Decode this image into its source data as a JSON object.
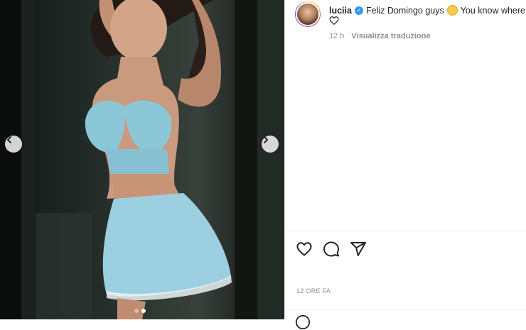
{
  "post": {
    "username": "luciia",
    "caption_pre": "Feliz Domingo guys",
    "caption_post": "You know where",
    "time_short": "12 h",
    "translate_label": "Visualizza traduzione",
    "time_long": "12 ORE FA"
  },
  "carousel": {
    "slide_count": 2,
    "active_slide": 2
  },
  "icons": {
    "verified": "verified-badge-icon",
    "caption_emoji": "smiling-face-emoji",
    "caption_heart": "white-heart-icon",
    "prev": "chevron-left-icon",
    "next": "chevron-right-icon",
    "like": "heart-icon",
    "comment": "comment-icon",
    "share": "send-icon",
    "add_emoji": "emoji-icon"
  },
  "colors": {
    "verified": "#3897f0",
    "muted_text": "#8e8e8e",
    "text": "#262626"
  }
}
